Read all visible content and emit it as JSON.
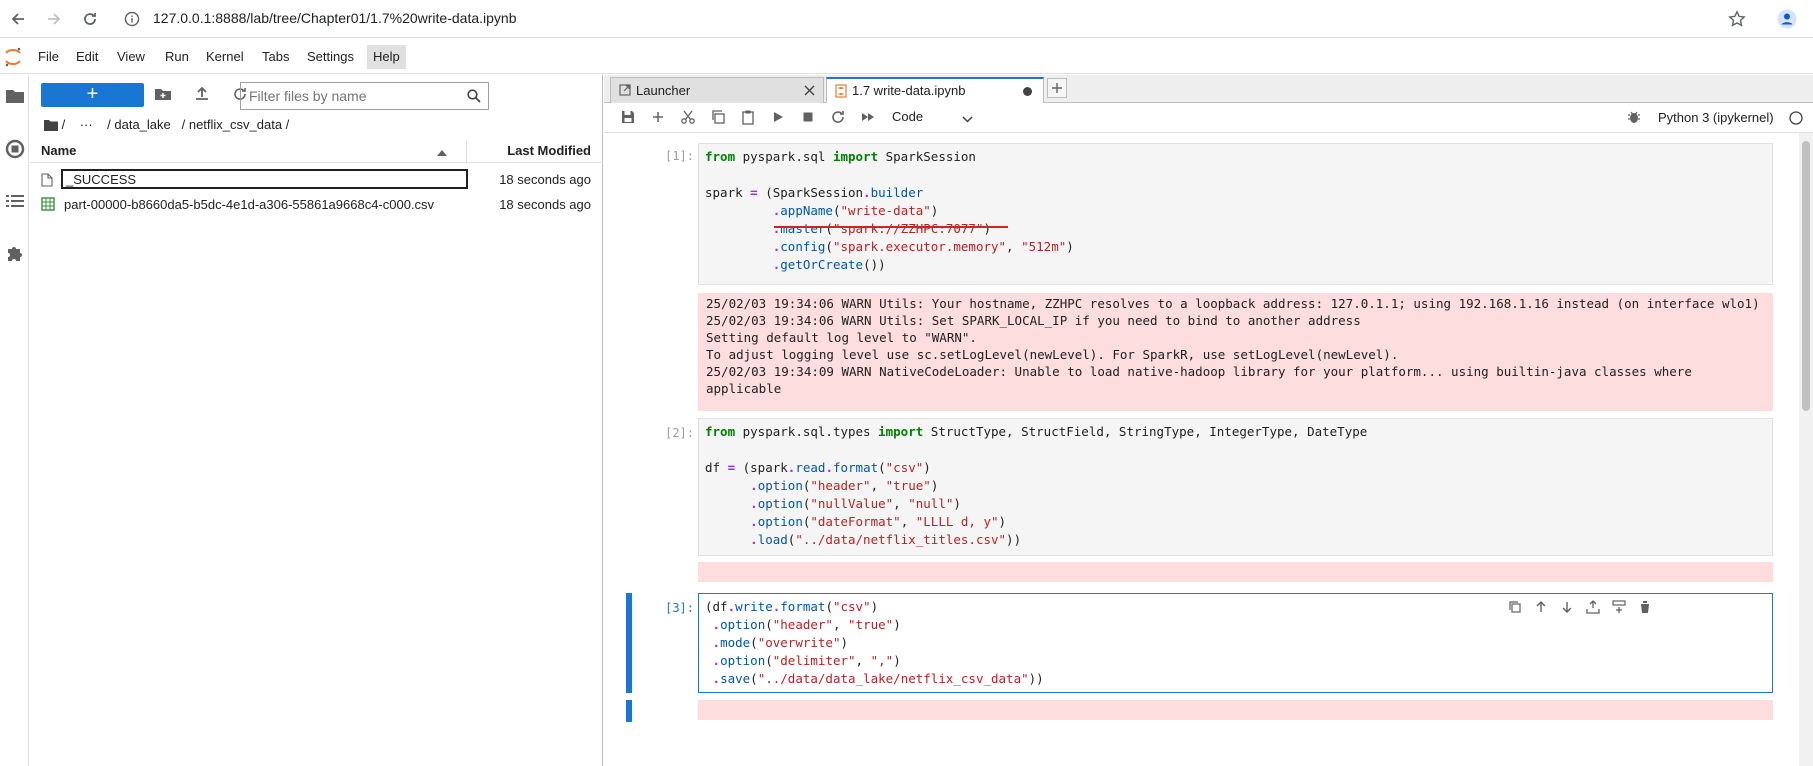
{
  "browser": {
    "url": "127.0.0.1:8888/lab/tree/Chapter01/1.7%20write-data.ipynb"
  },
  "menubar": {
    "items": [
      "File",
      "Edit",
      "View",
      "Run",
      "Kernel",
      "Tabs",
      "Settings",
      "Help"
    ],
    "active": "Help"
  },
  "filebrowser": {
    "new_label": "+",
    "filter_placeholder": "Filter files by name",
    "breadcrumbs": [
      "/",
      "···",
      "/ data_lake",
      "/ netflix_csv_data /"
    ],
    "columns": {
      "name": "Name",
      "modified": "Last Modified"
    },
    "files": [
      {
        "name": "_SUCCESS",
        "modified": "18 seconds ago",
        "icon": "file-icon"
      },
      {
        "name": "part-00000-b8660da5-b5dc-4e1d-a306-55861a9668c4-c000.csv",
        "modified": "18 seconds ago",
        "icon": "csv-icon"
      }
    ]
  },
  "tabs": [
    {
      "label": "Launcher",
      "active": false
    },
    {
      "label": "1.7 write-data.ipynb",
      "active": true
    }
  ],
  "toolbar": {
    "cell_type": "Code",
    "kernel": "Python 3 (ipykernel)"
  },
  "cells": [
    {
      "prompt": "[1]:",
      "output": "25/02/03 19:34:06 WARN Utils: Your hostname, ZZHPC resolves to a loopback address: 127.0.1.1; using 192.168.1.16 instead (on interface wlo1)\n25/02/03 19:34:06 WARN Utils: Set SPARK_LOCAL_IP if you need to bind to another address\nSetting default log level to \"WARN\".\nTo adjust logging level use sc.setLogLevel(newLevel). For SparkR, use setLogLevel(newLevel).\n25/02/03 19:34:09 WARN NativeCodeLoader: Unable to load native-hadoop library for your platform... using builtin-java classes where applicable"
    },
    {
      "prompt": "[2]:"
    },
    {
      "prompt": "[3]:"
    }
  ],
  "colors": {
    "accent": "#1976d2",
    "error_bg": "#fddddd"
  }
}
